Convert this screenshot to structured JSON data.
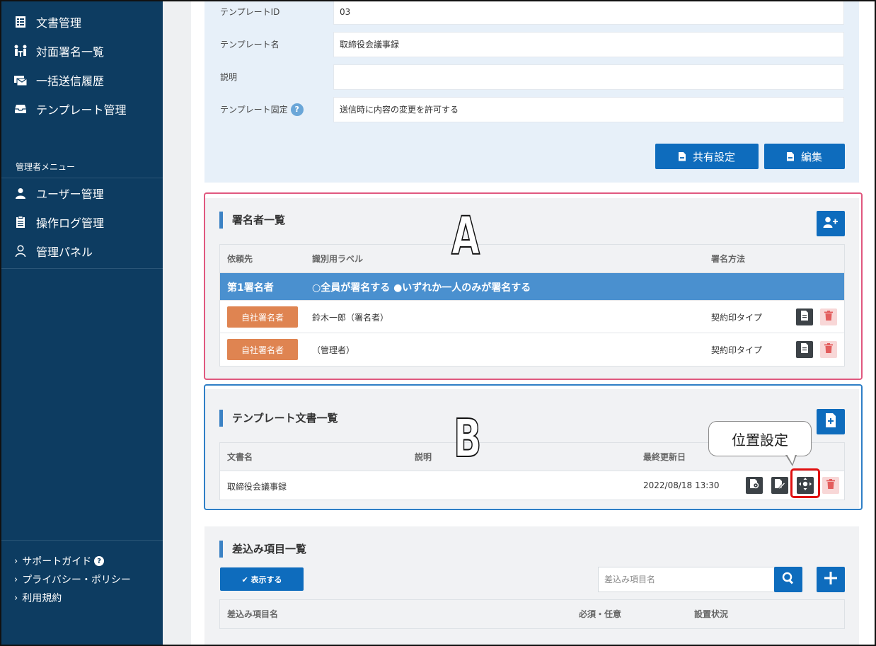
{
  "sidebar": {
    "nav": [
      {
        "label": "文書管理",
        "icon": "grid-document-icon"
      },
      {
        "label": "対面署名一覧",
        "icon": "meeting-icon"
      },
      {
        "label": "一括送信履歴",
        "icon": "bulk-send-icon"
      },
      {
        "label": "テンプレート管理",
        "icon": "inbox-tray-icon"
      }
    ],
    "admin_title": "管理者メニュー",
    "admin": [
      {
        "label": "ユーザー管理",
        "icon": "user-icon"
      },
      {
        "label": "操作ログ管理",
        "icon": "clipboard-icon"
      },
      {
        "label": "管理パネル",
        "icon": "user-outline-icon"
      }
    ],
    "footer": [
      {
        "label": "サポートガイド"
      },
      {
        "label": "プライバシー・ポリシー"
      },
      {
        "label": "利用規約"
      }
    ]
  },
  "template_info": {
    "id_label": "テンプレートID",
    "id_value": "03",
    "name_label": "テンプレート名",
    "name_value": "取締役会議事録",
    "desc_label": "説明",
    "desc_value": "",
    "fixed_label": "テンプレート固定",
    "fixed_value": "送信時に内容の変更を許可する",
    "share_button": "共有設定",
    "edit_button": "編集"
  },
  "signers": {
    "title": "署名者一覧",
    "headers": [
      "依頼先",
      "識別用ラベル",
      "署名方法"
    ],
    "group_label": "第1署名者",
    "group_options": "○全員が署名する ●いずれか一人のみが署名する",
    "rows": [
      {
        "tag": "自社署名者",
        "label": "鈴木一郎（署名者）",
        "method": "契約印タイプ"
      },
      {
        "tag": "自社署名者",
        "label": "（管理者）",
        "method": "契約印タイプ"
      }
    ]
  },
  "documents": {
    "title": "テンプレート文書一覧",
    "headers": [
      "文書名",
      "説明",
      "最終更新日"
    ],
    "rows": [
      {
        "name": "取締役会議事録",
        "desc": "",
        "updated": "2022/08/18 13:30"
      }
    ]
  },
  "merge_fields": {
    "title": "差込み項目一覧",
    "show_button": "✔ 表示する",
    "search_placeholder": "差込み項目名",
    "headers": [
      "差込み項目名",
      "必須・任意",
      "設置状況"
    ]
  },
  "annotations": {
    "label_a": "A",
    "label_b": "B",
    "bubble": "位置設定"
  },
  "colors": {
    "sidebar": "#0d3c61",
    "primary": "#0e6cbd",
    "group_row": "#4a90cf",
    "tag_orange": "#df8451",
    "outline_a": "#e0587f",
    "outline_b": "#2f7fc6",
    "highlight": "#e01010"
  }
}
